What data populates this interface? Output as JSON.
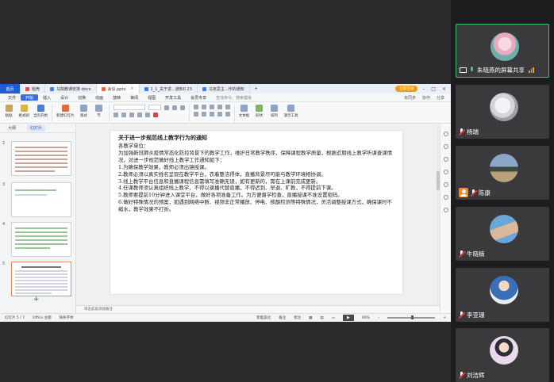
{
  "wps": {
    "tabs": [
      {
        "label": "首页",
        "kind": "home"
      },
      {
        "label": "稻壳",
        "icon_color": "#e84a3f"
      },
      {
        "label": "马院教课安排.docx",
        "icon_color": "#3d7bf0"
      },
      {
        "label": "会议.pptx",
        "icon_color": "#e6683c",
        "active": true
      },
      {
        "label": "1_1_关于进...通知0.23",
        "icon_color": "#3d7bf0"
      },
      {
        "label": "马克思主...作的通知",
        "icon_color": "#3d7bf0"
      }
    ],
    "user_label": "立即登录",
    "menu": [
      "文件",
      "开始",
      "插入",
      "设计",
      "切换",
      "动画",
      "放映",
      "审阅",
      "视图",
      "开发工具",
      "会员专享"
    ],
    "menu_active_index": 1,
    "menu_search": "查找命令、搜索模板",
    "menu_right": [
      "未同步",
      "协作",
      "分享"
    ],
    "ribbon": {
      "buttons": [
        "粘贴",
        "格式刷",
        "当页开始",
        "新建幻灯片",
        "版式",
        "节",
        "文本框",
        "形状",
        "排列",
        "演示工具"
      ]
    },
    "panel_tabs": [
      "大纲",
      "幻灯片"
    ],
    "slide_numbers": [
      "2",
      "3",
      "4",
      "5"
    ],
    "add_slide_icon": "+",
    "notes_placeholder": "单击此处添加备注",
    "slide": {
      "title": "关于进一步规范线上教学行为的通知",
      "paragraphs": [
        "各教学单位：",
        "为加强新冠肺炎疫情常态化防控背景下的教学工作，维护日常教学秩序，保障课程教学质量，根据近期线上教学听课查课情况，对进一步规范做好线上教学工作通知如下：",
        "1.为确保教学效果，教师必须出镜授课。",
        "2.教师必须以真实姓名呈现在教学平台，衣着整洁得体，直播背景尽可能与教学环境相协调。",
        "3.线上教学平台信息和直播课程信息需填写准确无误，如有更新的，需在上课前完成更新。",
        "4.任课教师须认真组织线上教学，不得以录播代替直播，不得迟到、早退、旷教，不得提前下课。",
        "5.教师要提前10分钟进入课堂平台，做好各项准备工作。为方便督学检查，直播授课不准设置密码。",
        "6.做好特殊情况的预案，如遇到网络中断、视频非正常播放、停电、核酸检测等特殊情况，灵活调整授课方式，确保课时不缩水，教学效果不打折。"
      ]
    },
    "status": {
      "slide_pos": "幻灯片 5 / 7",
      "theme": "Office 主题",
      "font_missing": "缺失字体",
      "smart_beautify": "智能美化",
      "notes": "备注",
      "comments": "批注",
      "zoom": "66%"
    }
  },
  "participants": [
    {
      "name": "朱晓燕的屏幕共享",
      "mic": "on",
      "sharing": true,
      "avatar": "lotus"
    },
    {
      "name": "杨瑞",
      "mic": "muted",
      "avatar": "rose"
    },
    {
      "name": "陈康",
      "mic": "muted",
      "host": true,
      "avatar": "tree"
    },
    {
      "name": "牛晓楠",
      "mic": "muted",
      "avatar": "hand"
    },
    {
      "name": "李亚珊",
      "mic": "muted",
      "avatar": "cartoon-boy"
    },
    {
      "name": "刘洁辉",
      "mic": "muted",
      "avatar": "cartoon-girl"
    }
  ],
  "colors": {
    "accent_blue": "#1f5dd6",
    "active_border": "#3ac96a",
    "muted_red": "#e23b3b"
  }
}
